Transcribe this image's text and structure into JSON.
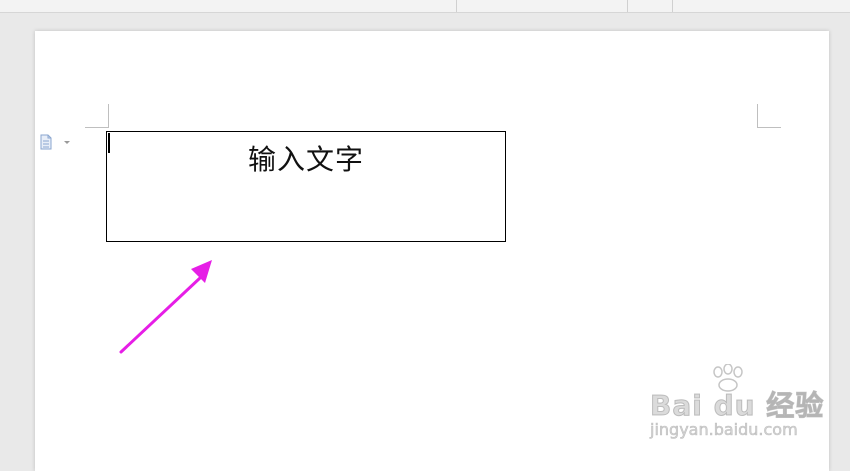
{
  "document": {
    "textbox_text": "输入文字"
  },
  "watermark": {
    "logo": "Bai du 经验",
    "url": "jingyan.baidu.com"
  },
  "colors": {
    "arrow": "#e61ee6",
    "page": "#ffffff",
    "background": "#e9e9e9",
    "textbox_border": "#000000"
  },
  "icons": {
    "doc_menu": "document-icon"
  }
}
